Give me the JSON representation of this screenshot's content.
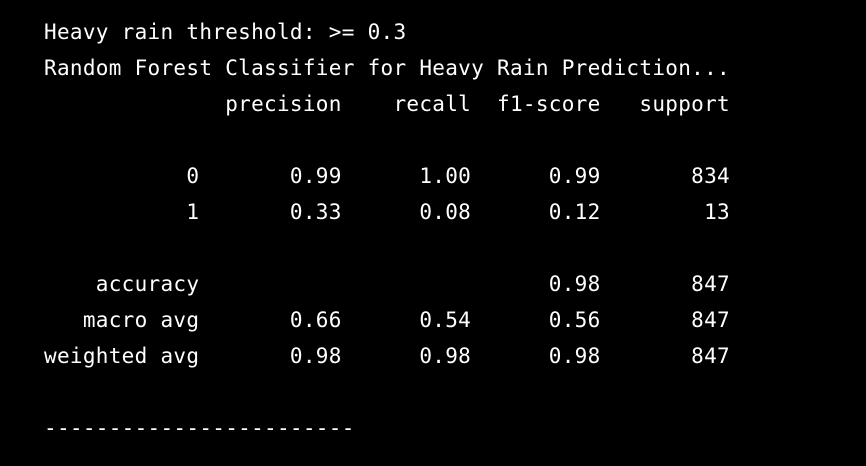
{
  "terminal": {
    "lines": [
      "Heavy rain threshold: >= 0.3",
      "Random Forest Classifier for Heavy Rain Prediction...",
      "              precision    recall  f1-score   support",
      "",
      "           0       0.99      1.00      0.99       834",
      "           1       0.33      0.08      0.12        13",
      "",
      "    accuracy                           0.98       847",
      "   macro avg       0.66      0.54      0.56       847",
      "weighted avg       0.98      0.98      0.98       847",
      "",
      "------------------------"
    ]
  }
}
